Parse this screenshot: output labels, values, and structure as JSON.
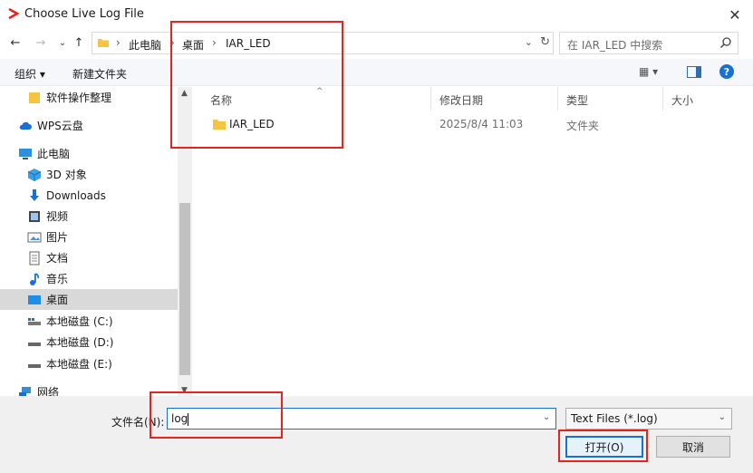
{
  "window": {
    "title": "Choose Live Log File",
    "close_glyph": "✕"
  },
  "nav": {
    "back_glyph": "←",
    "forward_glyph": "→",
    "recent_glyph": "⌄",
    "up_glyph": "↑"
  },
  "address": {
    "crumbs": [
      "此电脑",
      "桌面",
      "IAR_LED"
    ],
    "sep": "›",
    "dropdown_glyph": "⌄",
    "refresh_glyph": "↻"
  },
  "search": {
    "placeholder": "在 IAR_LED 中搜索"
  },
  "toolbar": {
    "organize": "组织 ▾",
    "new_folder": "新建文件夹",
    "view": "▦ ▾",
    "help": "?"
  },
  "sidebar": {
    "items": [
      {
        "label": "软件操作整理",
        "icon": "folder-icon"
      },
      {
        "label": "WPS云盘",
        "icon": "cloud-icon"
      },
      {
        "label": "此电脑",
        "icon": "computer-icon"
      },
      {
        "label": "3D 对象",
        "icon": "cube-icon"
      },
      {
        "label": "Downloads",
        "icon": "download-icon"
      },
      {
        "label": "视频",
        "icon": "video-icon"
      },
      {
        "label": "图片",
        "icon": "picture-icon"
      },
      {
        "label": "文档",
        "icon": "document-icon"
      },
      {
        "label": "音乐",
        "icon": "music-icon"
      },
      {
        "label": "桌面",
        "icon": "desktop-icon"
      },
      {
        "label": "本地磁盘 (C:)",
        "icon": "drive-icon"
      },
      {
        "label": "本地磁盘 (D:)",
        "icon": "drive-icon"
      },
      {
        "label": "本地磁盘 (E:)",
        "icon": "drive-icon"
      },
      {
        "label": "网络",
        "icon": "network-icon"
      }
    ],
    "selected": "桌面",
    "scroll_up": "▲",
    "scroll_down": "▼"
  },
  "filelist": {
    "columns": [
      "名称",
      "修改日期",
      "类型",
      "大小"
    ],
    "sort_glyph": "^",
    "rows": [
      {
        "name": "IAR_LED",
        "modified": "2025/8/4 11:03",
        "type": "文件夹",
        "size": ""
      }
    ]
  },
  "bottom": {
    "filename_label": "文件名(N):",
    "filename_value": "log",
    "filename_dd": "⌄",
    "filetype": "Text Files (*.log)",
    "filetype_dd": "⌄",
    "open_label": "打开(O)",
    "cancel_label": "取消"
  },
  "colors": {
    "accent": "#1a6fd6",
    "highlight_box": "#e8231b",
    "folder": "#f5c542"
  }
}
